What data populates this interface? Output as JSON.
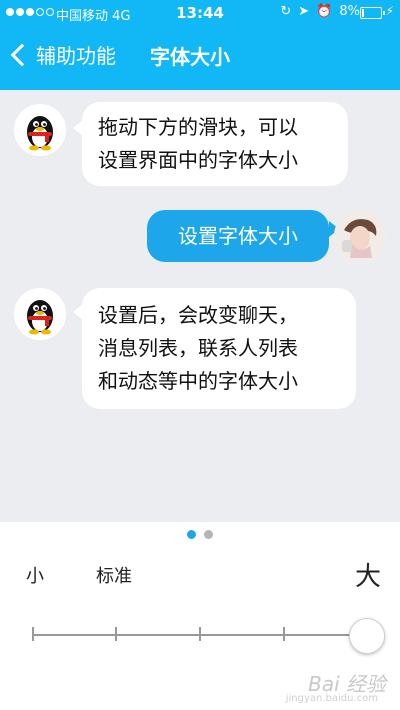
{
  "status_bar": {
    "carrier": "中国移动",
    "network": "4G",
    "time": "13:44",
    "battery": "8%",
    "battery_level": 0.08
  },
  "nav": {
    "back_label": "辅助功能",
    "title": "字体大小"
  },
  "chat": {
    "messages": [
      {
        "side": "left",
        "avatar": "qq-penguin-icon",
        "lines": [
          "拖动下方的滑块，可以",
          "设置界面中的字体大小"
        ]
      },
      {
        "side": "right",
        "avatar": "user-avatar-photo",
        "lines": [
          "设置字体大小"
        ]
      },
      {
        "side": "left",
        "avatar": "qq-penguin-icon",
        "lines": [
          "设置后，会改变聊天，",
          "消息列表，联系人列表",
          "和动态等中的字体大小"
        ]
      }
    ]
  },
  "pager": {
    "pages": 2,
    "active": 0
  },
  "font_size": {
    "label_small": "小",
    "label_standard": "标准",
    "label_large": "大",
    "steps": 5,
    "selected_index": 4
  },
  "colors": {
    "accent": "#12b7f5",
    "bubble_blue": "#1da7ea",
    "chat_bg": "#ebedf1"
  },
  "watermark": {
    "text": "Bai 经验",
    "sub": "jingyan.baidu.com"
  }
}
